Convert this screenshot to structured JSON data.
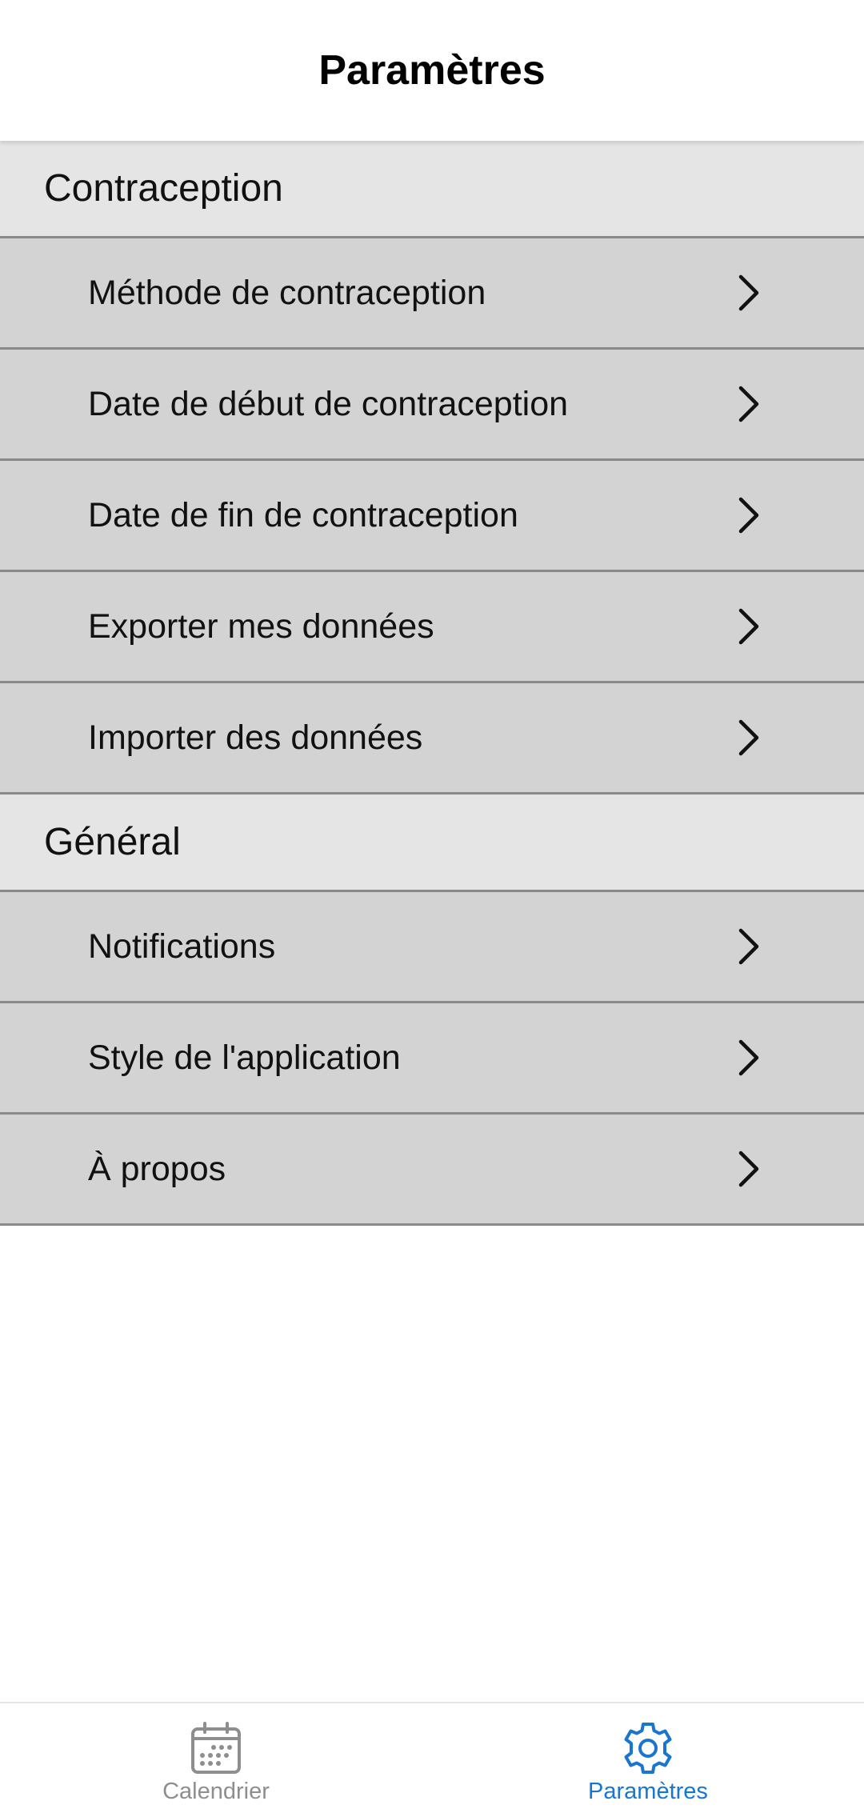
{
  "header": {
    "title": "Paramètres"
  },
  "sections": [
    {
      "title": "Contraception",
      "items": [
        {
          "label": "Méthode de contraception"
        },
        {
          "label": "Date de début de contraception"
        },
        {
          "label": "Date de fin de contraception"
        },
        {
          "label": "Exporter mes données"
        },
        {
          "label": "Importer des données"
        }
      ]
    },
    {
      "title": "Général",
      "items": [
        {
          "label": "Notifications"
        },
        {
          "label": "Style de l'application"
        },
        {
          "label": "À propos"
        }
      ]
    }
  ],
  "tabs": [
    {
      "label": "Calendrier",
      "icon": "calendar-icon",
      "active": false
    },
    {
      "label": "Paramètres",
      "icon": "gear-icon",
      "active": true
    }
  ],
  "colors": {
    "accent": "#1a75d1",
    "inactive": "#8e8e8e",
    "section_bg": "#e5e5e5",
    "row_bg": "#d3d3d3",
    "divider": "#8a8a8a"
  }
}
